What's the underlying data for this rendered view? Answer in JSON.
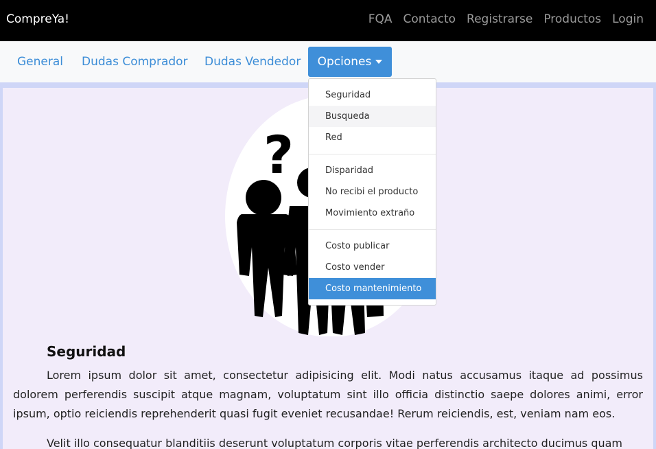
{
  "navbar": {
    "brand": "CompreYa!",
    "links": [
      "FQA",
      "Contacto",
      "Registrarse",
      "Productos",
      "Login"
    ]
  },
  "subnav": {
    "tabs": [
      "General",
      "Dudas Comprador",
      "Dudas Vendedor"
    ],
    "options_label": "Opciones"
  },
  "dropdown": {
    "groups": [
      [
        "Seguridad",
        "Busqueda",
        "Red"
      ],
      [
        "Disparidad",
        "No recibi el producto",
        "Movimiento extraño"
      ],
      [
        "Costo publicar",
        "Costo vender",
        "Costo mantenimiento"
      ]
    ],
    "hovered": "Busqueda",
    "active": "Costo mantenimiento"
  },
  "illustration": {
    "icon": "question-people-icon",
    "question_mark": "?"
  },
  "section": {
    "title": "Seguridad",
    "paragraphs": [
      "Lorem ipsum dolor sit amet, consectetur adipisicing elit. Modi natus accusamus itaque ad possimus dolorem perferendis suscipit atque magnam, voluptatum sint illo officia distinctio saepe dolores animi, error ipsum, optio reiciendis reprehenderit quasi fugit eveniet recusandae! Rerum reiciendis, est, veniam nam eos.",
      "Velit illo consequatur blanditiis deserunt voluptatum corporis vitae perferendis architecto ducimus quam"
    ]
  },
  "colors": {
    "navbar_bg": "#000000",
    "accent": "#3f8fd9",
    "content_bg": "#f2ecfa"
  }
}
